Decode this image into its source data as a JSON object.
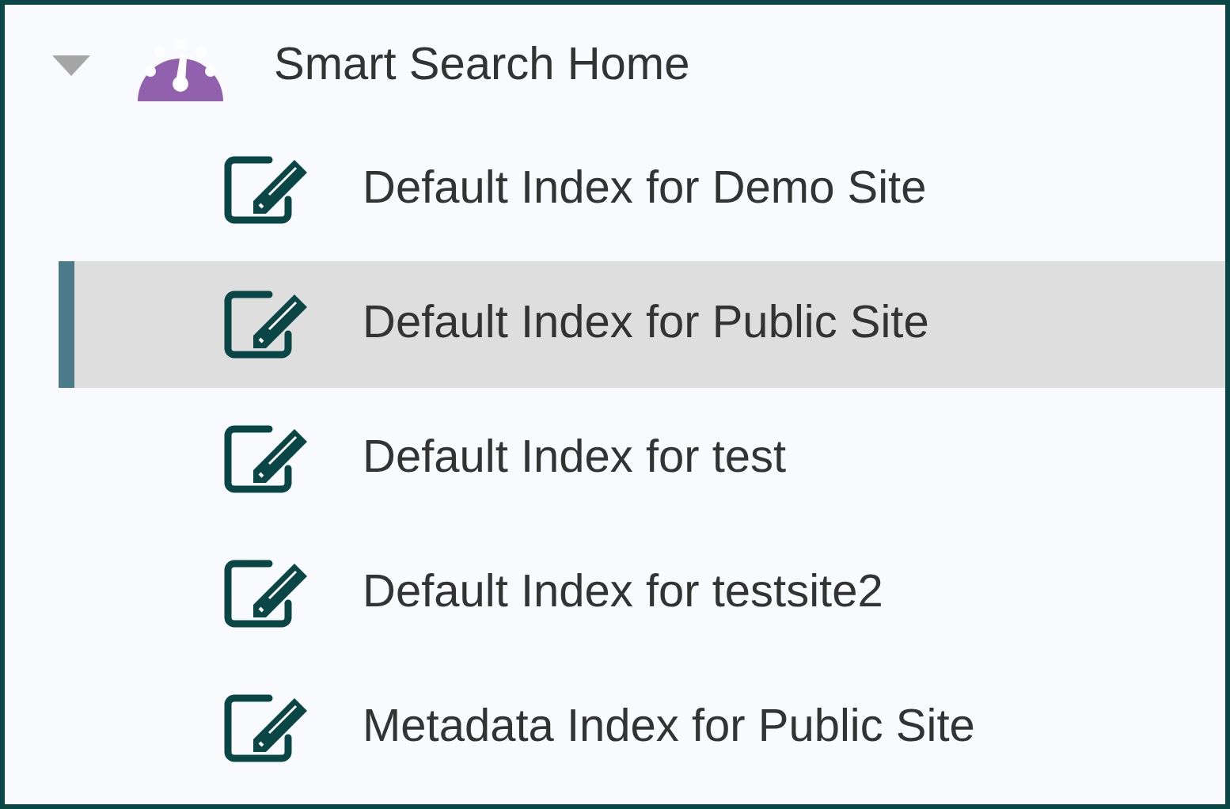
{
  "tree": {
    "label": "Smart Search Home",
    "expanded": true,
    "children": [
      {
        "label": "Default Index for Demo Site",
        "selected": false
      },
      {
        "label": "Default Index for Public Site",
        "selected": true
      },
      {
        "label": "Default Index for test",
        "selected": false
      },
      {
        "label": "Default Index for testsite2",
        "selected": false
      },
      {
        "label": "Metadata Index for Public Site",
        "selected": false
      }
    ]
  }
}
